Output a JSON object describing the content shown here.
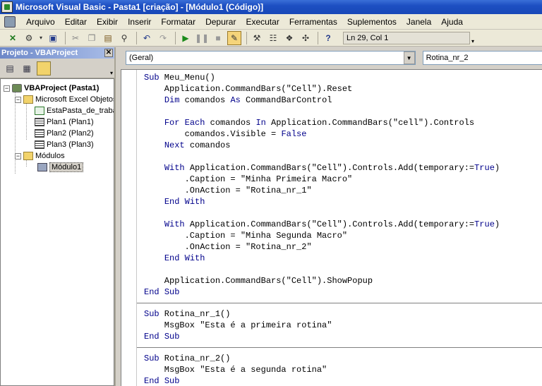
{
  "window": {
    "title": "Microsoft Visual Basic - Pasta1 [criação] - [Módulo1 (Código)]"
  },
  "menubar": {
    "items": [
      "Arquivo",
      "Editar",
      "Exibir",
      "Inserir",
      "Formatar",
      "Depurar",
      "Executar",
      "Ferramentas",
      "Suplementos",
      "Janela",
      "Ajuda"
    ]
  },
  "toolbar": {
    "position_text": "Ln 29, Col 1"
  },
  "project_pane": {
    "title": "Projeto - VBAProject",
    "tree": {
      "project": "VBAProject (Pasta1)",
      "excel_objects_folder": "Microsoft Excel Objetos",
      "workbook": "EstaPasta_de_trabalho",
      "sheets": [
        "Plan1 (Plan1)",
        "Plan2 (Plan2)",
        "Plan3 (Plan3)"
      ],
      "modules_folder": "Módulos",
      "module": "Módulo1"
    }
  },
  "code_window": {
    "object_dropdown": "(Geral)",
    "procedure_dropdown": "Rotina_nr_2",
    "lines": [
      "Sub Meu_Menu()",
      "    Application.CommandBars(\"Cell\").Reset",
      "    Dim comandos As CommandBarControl",
      "",
      "    For Each comandos In Application.CommandBars(\"cell\").Controls",
      "        comandos.Visible = False",
      "    Next comandos",
      "",
      "    With Application.CommandBars(\"Cell\").Controls.Add(temporary:=True)",
      "        .Caption = \"Minha Primeira Macro\"",
      "        .OnAction = \"Rotina_nr_1\"",
      "    End With",
      "",
      "    With Application.CommandBars(\"Cell\").Controls.Add(temporary:=True)",
      "        .Caption = \"Minha Segunda Macro\"",
      "        .OnAction = \"Rotina_nr_2\"",
      "    End With",
      "",
      "    Application.CommandBars(\"Cell\").ShowPopup",
      "End Sub",
      "---",
      "Sub Rotina_nr_1()",
      "    MsgBox \"Esta é a primeira rotina\"",
      "End Sub",
      "---",
      "Sub Rotina_nr_2()",
      "    MsgBox \"Esta é a segunda rotina\"",
      "End Sub"
    ]
  }
}
